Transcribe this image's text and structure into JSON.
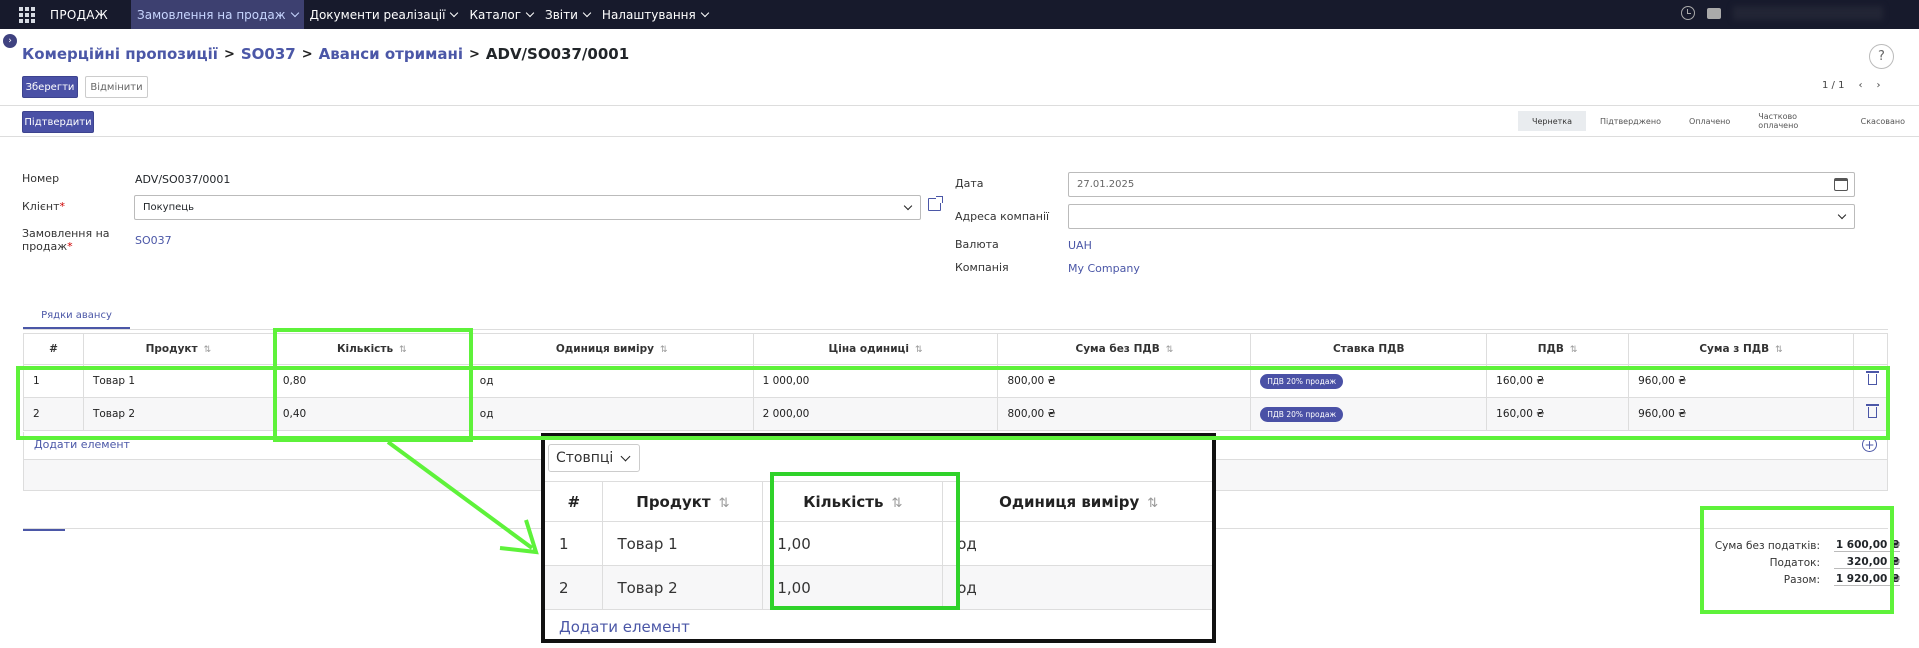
{
  "topbar": {
    "brand": "ПРОДАЖ",
    "menu": [
      {
        "label": "Замовлення на продаж",
        "active": true
      },
      {
        "label": "Документи реалізації",
        "active": false
      },
      {
        "label": "Каталог",
        "active": false
      },
      {
        "label": "Звіти",
        "active": false
      },
      {
        "label": "Налаштування",
        "active": false
      }
    ]
  },
  "breadcrumbs": {
    "items": [
      "Комерційні пропозиції",
      "SO037",
      "Аванси отримані"
    ],
    "current": "ADV/SO037/0001"
  },
  "toolbar": {
    "save": "Зберегти",
    "discard": "Відмінити",
    "confirm": "Підтвердити",
    "pager": "1 / 1",
    "help": "?"
  },
  "status_bar": [
    "Чернетка",
    "Підтверджено",
    "Оплачено",
    "Частково оплачено",
    "Скасовано"
  ],
  "form": {
    "number_label": "Номер",
    "number_value": "ADV/SO037/0001",
    "client_label": "Клієнт",
    "client_value": "Покупець",
    "order_label_1": "Замовлення на",
    "order_label_2": "продаж",
    "order_value": "SO037",
    "required_mark": "*",
    "date_label": "Дата",
    "date_value": "27.01.2025",
    "company_address_label": "Адреса компанії",
    "company_address_value": "",
    "currency_label": "Валюта",
    "currency_value": "UAH",
    "company_label": "Компанія",
    "company_value": "My Company"
  },
  "tab": "Рядки авансу",
  "lines": {
    "headers": [
      "#",
      "Продукт",
      "Кількість",
      "Одиниця виміру",
      "Ціна одиниці",
      "Сума без ПДВ",
      "Ставка ПДВ",
      "ПДВ",
      "Сума з ПДВ"
    ],
    "rows": [
      {
        "n": "1",
        "product": "Товар 1",
        "qty": "0,80",
        "uom": "од",
        "price": "1 000,00",
        "subtotal": "800,00 ₴",
        "tax": "ПДВ 20% продаж",
        "vat": "160,00 ₴",
        "total": "960,00 ₴"
      },
      {
        "n": "2",
        "product": "Товар 2",
        "qty": "0,40",
        "uom": "од",
        "price": "2 000,00",
        "subtotal": "800,00 ₴",
        "tax": "ПДВ 20% продаж",
        "vat": "160,00 ₴",
        "total": "960,00 ₴"
      }
    ],
    "add": "Додати елемент"
  },
  "totals": {
    "untaxed_label": "Сума без податків:",
    "untaxed_value": "1 600,00 ₴",
    "tax_label": "Податок:",
    "tax_value": "320,00 ₴",
    "total_label": "Разом:",
    "total_value": "1 920,00 ₴"
  },
  "zoom": {
    "columns": "Стовпці",
    "headers": [
      "#",
      "Продукт",
      "Кількість",
      "Одиниця виміру"
    ],
    "rows": [
      {
        "n": "1",
        "product": "Товар 1",
        "qty": "1,00",
        "uom": "од"
      },
      {
        "n": "2",
        "product": "Товар 2",
        "qty": "1,00",
        "uom": "од"
      }
    ],
    "add": "Додати елемент"
  },
  "colors": {
    "accent": "#4a51a6",
    "highlight": "#5ef23a",
    "topbar": "#171a2c"
  }
}
